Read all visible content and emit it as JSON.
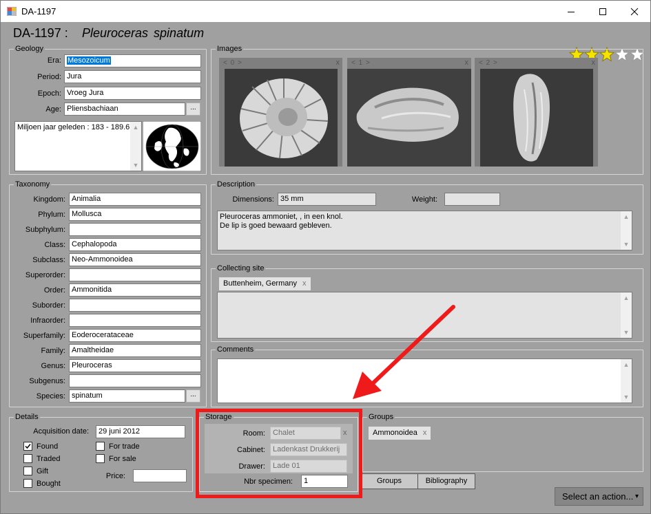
{
  "window": {
    "title": "DA-1197",
    "minimize_glyph": "─",
    "maximize_glyph": "☐",
    "close_glyph": "✕"
  },
  "header": {
    "code": "DA-1197 :",
    "species_name": "Pleuroceras  spinatum",
    "rating_stars": 3,
    "rating_max": 5
  },
  "geology": {
    "legend": "Geology",
    "era": {
      "label": "Era:",
      "value": "Mesozoicum"
    },
    "period": {
      "label": "Period:",
      "value": "Jura"
    },
    "epoch": {
      "label": "Epoch:",
      "value": "Vroeg Jura"
    },
    "age": {
      "label": "Age:",
      "value": "Pliensbachiaan",
      "button": "..."
    },
    "time_text": "Miljoen jaar geleden : 183 - 189.6"
  },
  "taxonomy": {
    "legend": "Taxonomy",
    "rows": [
      {
        "label": "Kingdom:",
        "value": "Animalia"
      },
      {
        "label": "Phylum:",
        "value": "Mollusca"
      },
      {
        "label": "Subphylum:",
        "value": ""
      },
      {
        "label": "Class:",
        "value": "Cephalopoda"
      },
      {
        "label": "Subclass:",
        "value": "Neo-Ammonoidea"
      },
      {
        "label": "Superorder:",
        "value": ""
      },
      {
        "label": "Order:",
        "value": "Ammonitida"
      },
      {
        "label": "Suborder:",
        "value": ""
      },
      {
        "label": "Infraorder:",
        "value": ""
      },
      {
        "label": "Superfamily:",
        "value": "Eoderocerataceae"
      },
      {
        "label": "Family:",
        "value": "Amaltheidae"
      },
      {
        "label": "Genus:",
        "value": "Pleuroceras"
      },
      {
        "label": "Subgenus:",
        "value": ""
      },
      {
        "label": "Species:",
        "value": "spinatum"
      }
    ],
    "species_button": "..."
  },
  "images": {
    "legend": "Images",
    "items": [
      {
        "nav": "< 0 >",
        "close": "x"
      },
      {
        "nav": "< 1 >",
        "close": "x"
      },
      {
        "nav": "< 2 >",
        "close": "x"
      }
    ]
  },
  "description": {
    "legend": "Description",
    "dimensions_label": "Dimensions:",
    "dimensions_value": "35 mm",
    "weight_label": "Weight:",
    "weight_value": "",
    "text_line1": "Pleuroceras ammoniet, , in een knol.",
    "text_line2": "De lip is goed bewaard gebleven."
  },
  "collecting_site": {
    "legend": "Collecting site",
    "tag": "Buttenheim, Germany",
    "tag_close": "x"
  },
  "comments": {
    "legend": "Comments",
    "value": ""
  },
  "details": {
    "legend": "Details",
    "acquisition_label": "Acquisition date:",
    "acquisition_value": "29 juni 2012",
    "checkboxes": [
      {
        "label": "Found",
        "checked": true
      },
      {
        "label": "Traded",
        "checked": false
      },
      {
        "label": "Gift",
        "checked": false
      },
      {
        "label": "Bought",
        "checked": false
      },
      {
        "label": "For trade",
        "checked": false
      },
      {
        "label": "For sale",
        "checked": false
      }
    ],
    "price_label": "Price:",
    "price_value": ""
  },
  "storage": {
    "legend": "Storage",
    "room_label": "Room:",
    "room_value": "Chalet",
    "room_clear": "x",
    "cabinet_label": "Cabinet:",
    "cabinet_value": "Ladenkast Drukkerij",
    "drawer_label": "Drawer:",
    "drawer_value": "Lade 01",
    "nbr_label": "Nbr specimen:",
    "nbr_value": "1"
  },
  "groups": {
    "legend": "Groups",
    "tag": "Ammonoidea",
    "tag_close": "x"
  },
  "bottom_tabs": {
    "groups": "Groups",
    "bibliography": "Bibliography"
  },
  "action_button": {
    "label": "Select an action...",
    "arrow": "▾"
  },
  "colors": {
    "form_background": "#a0a0a0",
    "selection_blue": "#0078d7",
    "star_yellow": "#f6e400",
    "annotation_red": "#ef1b1b"
  }
}
